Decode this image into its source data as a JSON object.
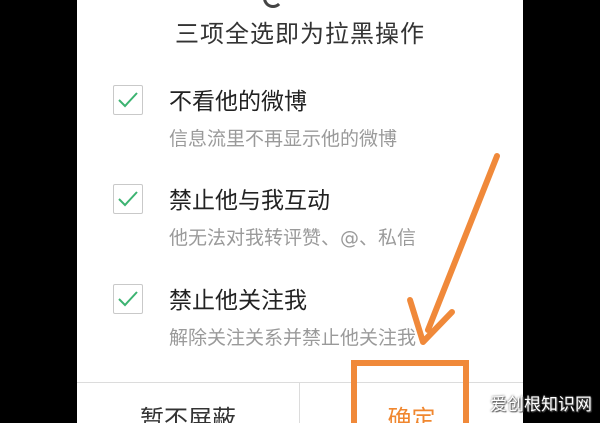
{
  "dialog": {
    "heading": "三项全选即为拉黑操作",
    "options": [
      {
        "title": "不看他的微博",
        "description": "信息流里不再显示他的微博",
        "checked": true
      },
      {
        "title": "禁止他与我互动",
        "description": "他无法对我转评赞、@、私信",
        "checked": true
      },
      {
        "title": "禁止他关注我",
        "description": "解除关注关系并禁止他关注我",
        "checked": true
      }
    ],
    "buttons": {
      "cancel_label": "暂不屏蔽",
      "confirm_label": "确定"
    }
  },
  "colors": {
    "checkmark": "#3cb371",
    "annotation": "#f0893a",
    "confirm_text": "#f0872f"
  },
  "icons": {
    "checkbox_check": "checkmark-icon",
    "annotation_arrow": "arrow-icon"
  },
  "watermark": "爱创根知识网"
}
